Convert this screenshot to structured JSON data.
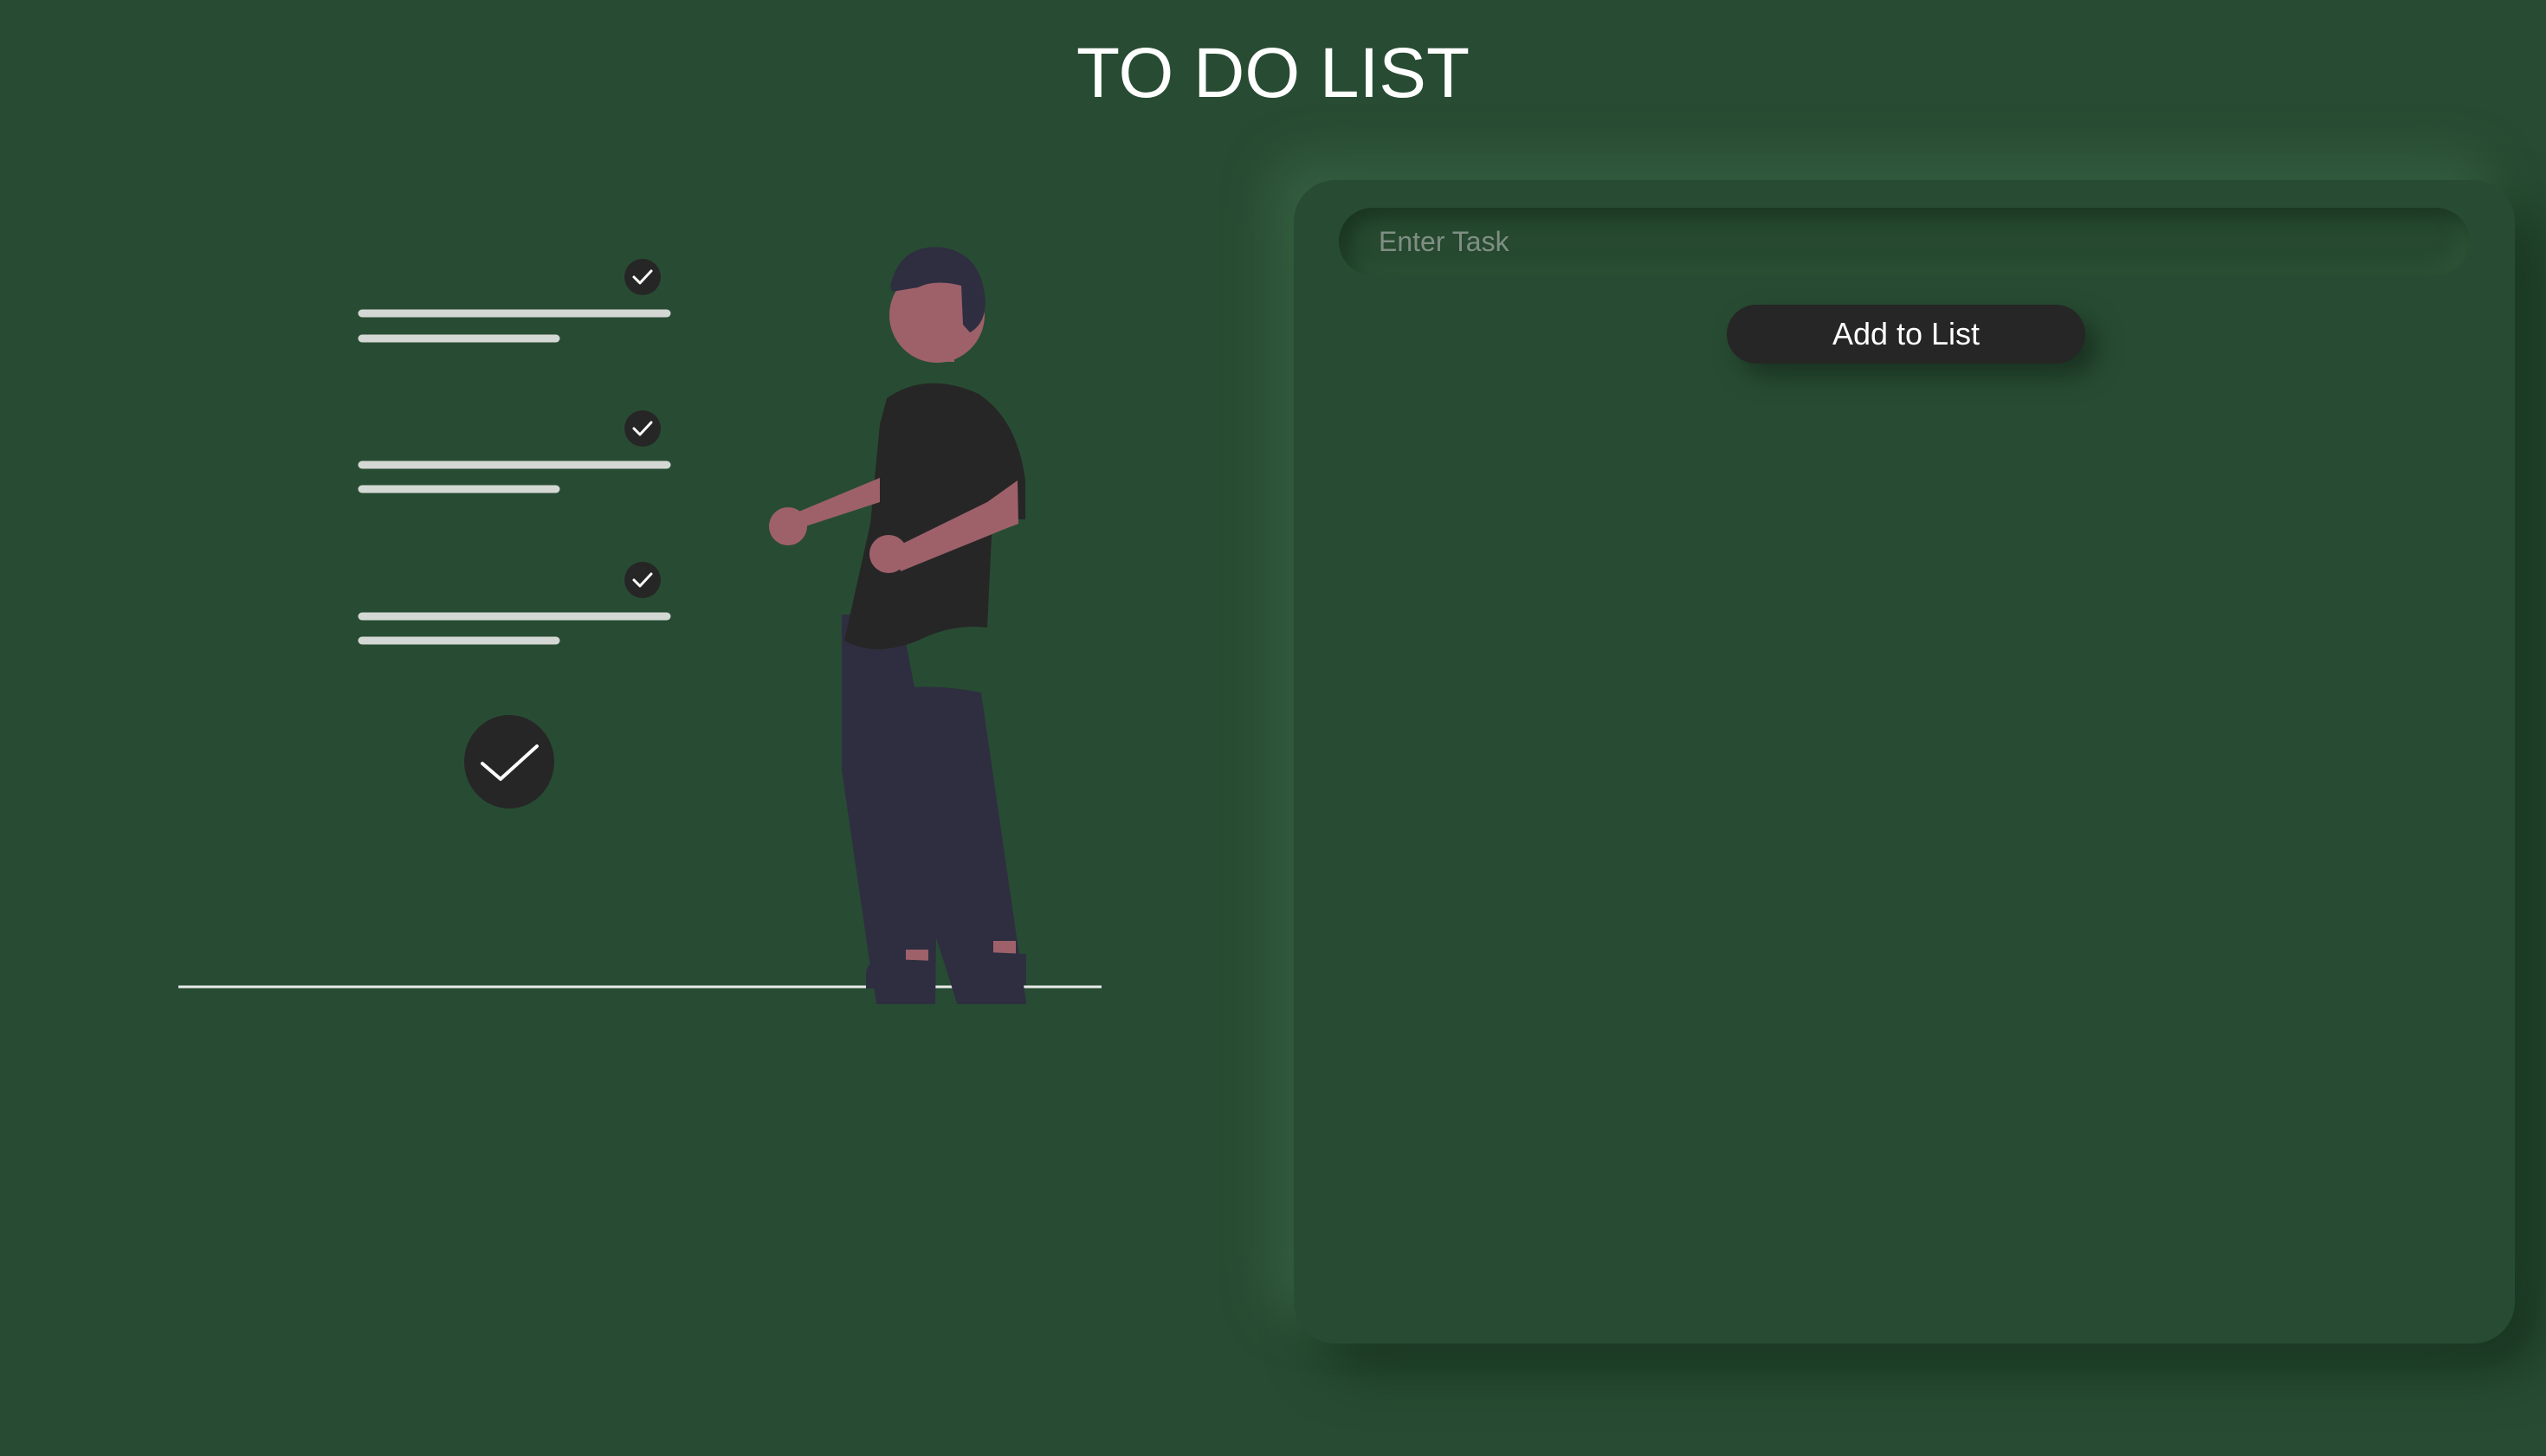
{
  "header": {
    "title": "TO DO LIST"
  },
  "illustration": {
    "description_icons": [
      "check-icon",
      "person-figure"
    ],
    "colors": {
      "background": "#284c33",
      "line": "#d4d8d5",
      "check_circle": "#262626",
      "skin": "#9e616a",
      "hair": "#2f2e41",
      "shirt": "#262626",
      "pants": "#2f2e41"
    }
  },
  "todo_panel": {
    "input": {
      "placeholder": "Enter Task",
      "value": ""
    },
    "add_button_label": "Add to List",
    "tasks": []
  },
  "colors": {
    "page_background": "#284c33",
    "button_background": "#262626",
    "button_text": "#ffffff",
    "title_text": "#ffffff"
  }
}
